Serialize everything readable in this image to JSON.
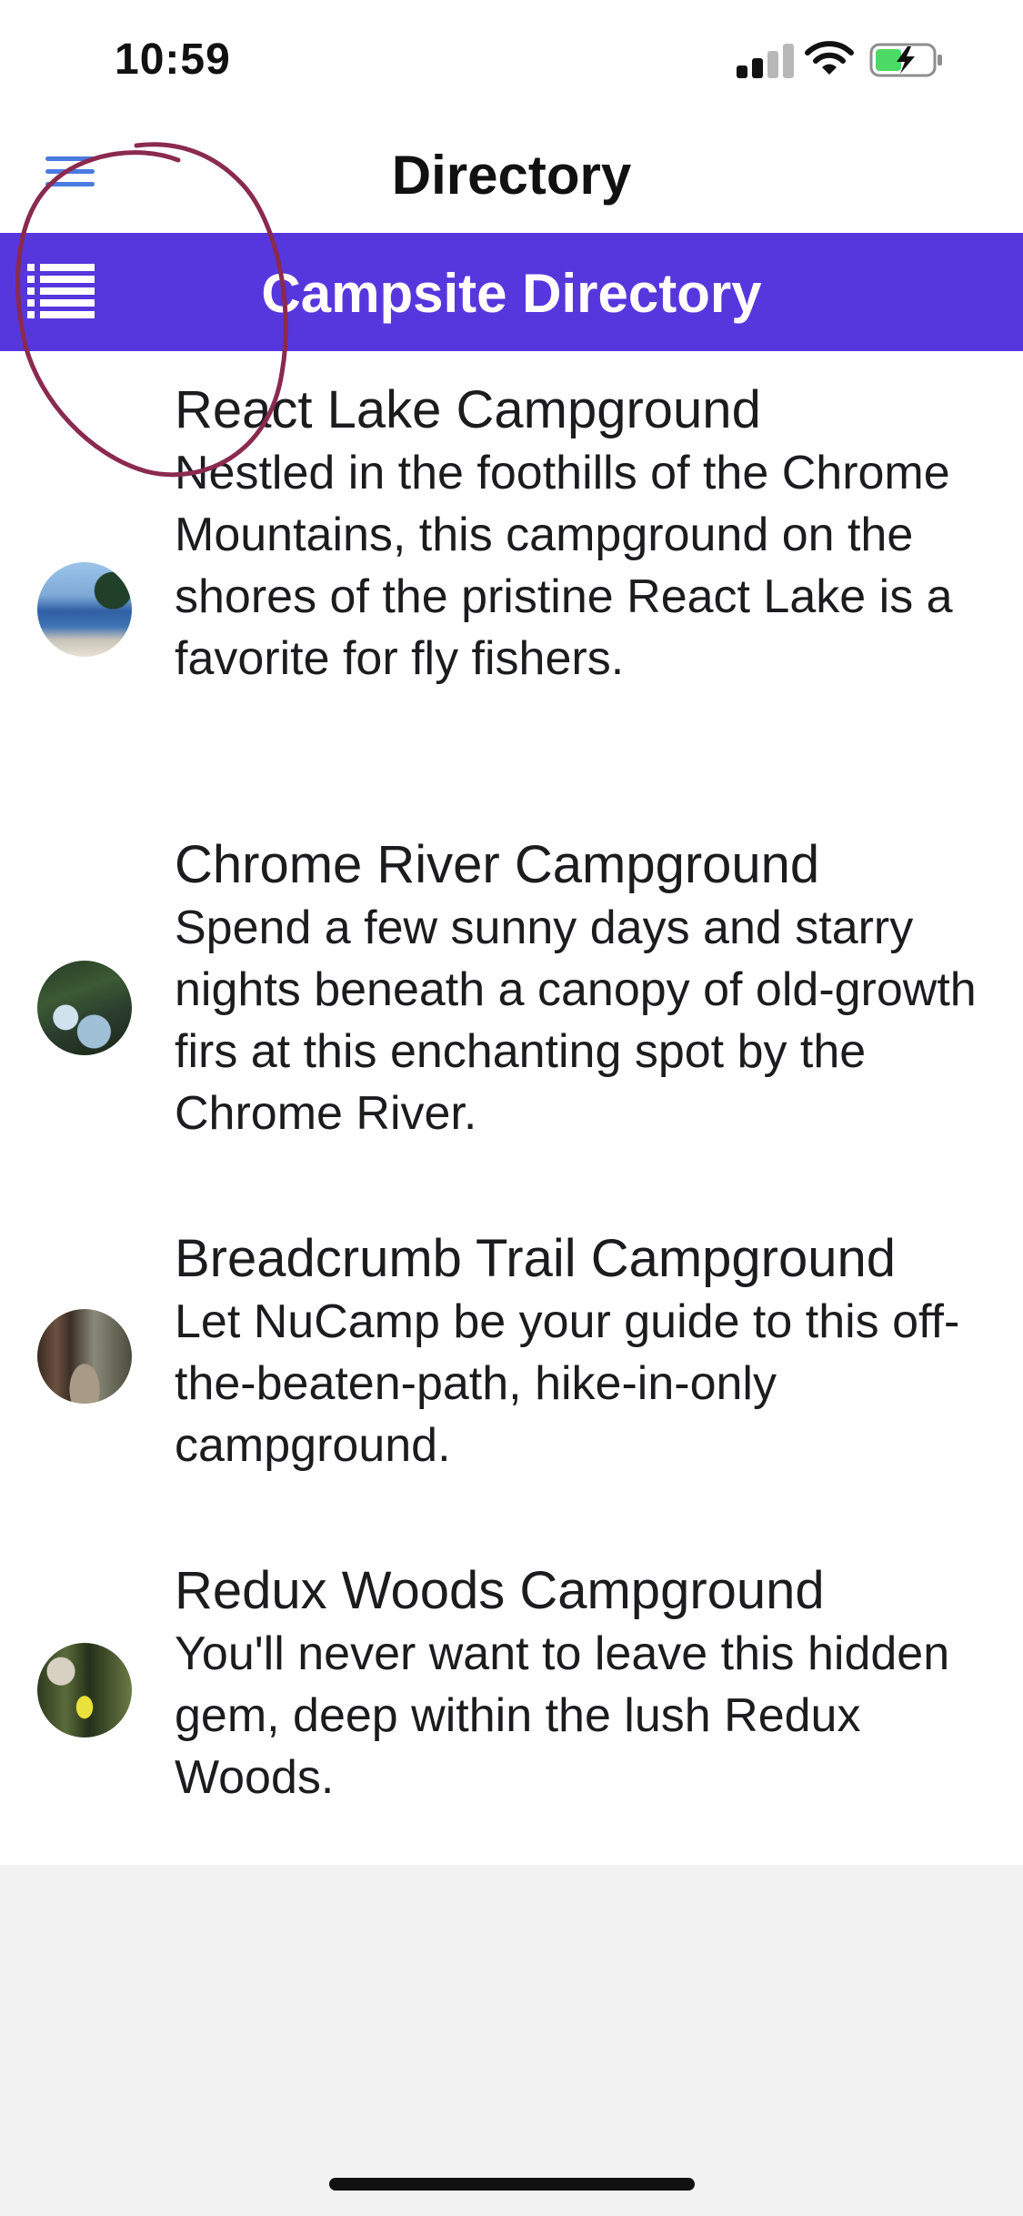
{
  "status_bar": {
    "time": "10:59"
  },
  "header": {
    "title": "Directory",
    "menu_icon": "hamburger-menu-icon"
  },
  "banner": {
    "title": "Campsite Directory",
    "icon": "list-icon",
    "background": "#5637dd"
  },
  "campsites": [
    {
      "name": "React Lake Campground",
      "description": "Nestled in the foothills of the Chrome Mountains, this campground on the shores of the pristine React Lake is a favorite for fly fishers."
    },
    {
      "name": "Chrome River Campground",
      "description": "Spend a few sunny days and starry nights beneath a canopy of old-growth firs at this enchanting spot by the Chrome River."
    },
    {
      "name": "Breadcrumb Trail Campground",
      "description": "Let NuCamp be your guide to this off-the-beaten-path, hike-in-only campground."
    },
    {
      "name": "Redux Woods Campground",
      "description": "You'll never want to leave this hidden gem, deep within the lush Redux Woods."
    }
  ],
  "colors": {
    "accent": "#5637dd",
    "menu_icon": "#4a7be0",
    "annotation": "#8a2a4e"
  }
}
